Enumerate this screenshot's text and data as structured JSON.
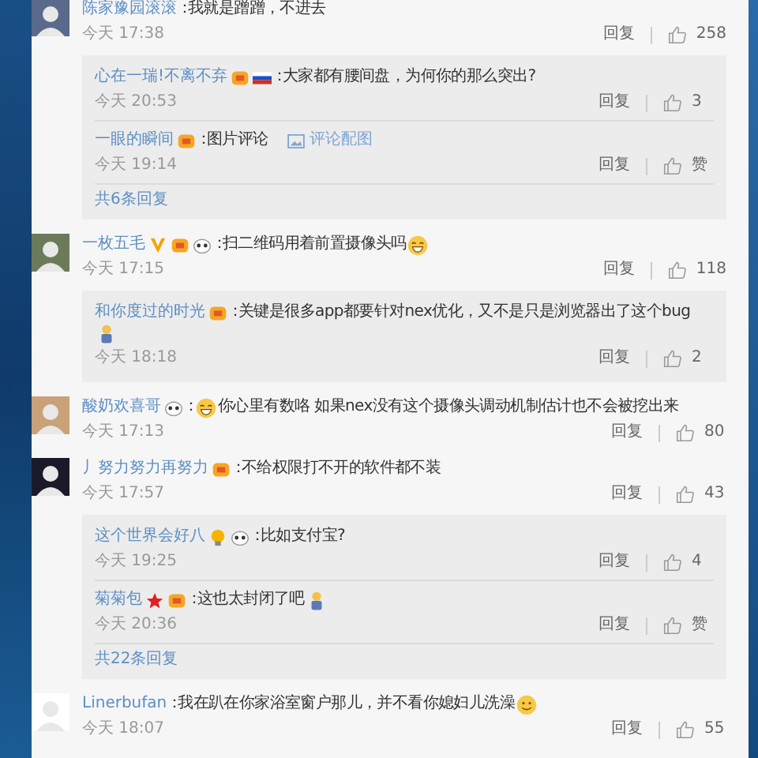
{
  "comments": [
    {
      "user": "陈家豫园滚滚",
      "colon": "：",
      "text": "我就是蹭蹭，不进去",
      "time": "今天 17:38",
      "reply": "回复",
      "likes": "258",
      "replies": [
        {
          "user": "心在一瑞!不离不弃",
          "badges": [
            {
              "kind": "member"
            },
            {
              "kind": "flag"
            }
          ],
          "colon": "：",
          "text": "大家都有腰间盘，为何你的那么突出?",
          "time": "今天 20:53",
          "reply": "回复",
          "likes": "3"
        },
        {
          "user": "一眼的瞬间",
          "badges": [
            {
              "kind": "member"
            }
          ],
          "colon": "：",
          "text": "图片评论",
          "attachment": "评论配图",
          "time": "今天 19:14",
          "reply": "回复",
          "likes": "赞"
        }
      ],
      "more": "共6条回复"
    },
    {
      "user": "一枚五毛",
      "badges": [
        {
          "kind": "vip"
        },
        {
          "kind": "member"
        },
        {
          "kind": "panda"
        }
      ],
      "colon": "：",
      "text": "扫二维码用着前置摄像头吗",
      "emoji_after": {
        "kind": "grin"
      },
      "time": "今天 17:15",
      "reply": "回复",
      "likes": "118",
      "replies": [
        {
          "user": "和你度过的时光",
          "badges": [
            {
              "kind": "member"
            }
          ],
          "colon": "：",
          "text": "关键是很多app都要针对nex优化，又不是只是浏览器出了这个bug",
          "emoji_after": {
            "kind": "figure"
          },
          "time": "今天 18:18",
          "reply": "回复",
          "likes": "2"
        }
      ]
    },
    {
      "user": "酸奶欢喜哥",
      "badges": [
        {
          "kind": "panda"
        }
      ],
      "colon": "：",
      "emoji_before": {
        "kind": "grin"
      },
      "text": "你心里有数咯 如果nex没有这个摄像头调动机制估计也不会被挖出来",
      "time": "今天 17:13",
      "reply": "回复",
      "likes": "80"
    },
    {
      "user": "丿努力努力再努力",
      "badges": [
        {
          "kind": "member"
        }
      ],
      "colon": "：",
      "text": "不给权限打不开的软件都不装",
      "time": "今天 17:57",
      "reply": "回复",
      "likes": "43",
      "replies": [
        {
          "user": "这个世界会好八",
          "badges": [
            {
              "kind": "bulb"
            },
            {
              "kind": "panda"
            }
          ],
          "colon": "：",
          "text": "比如支付宝?",
          "time": "今天 19:25",
          "reply": "回复",
          "likes": "4"
        },
        {
          "user": "菊菊包",
          "badges": [
            {
              "kind": "star"
            },
            {
              "kind": "member"
            }
          ],
          "colon": "：",
          "text": "这也太封闭了吧",
          "emoji_after": {
            "kind": "figure"
          },
          "time": "今天 20:36",
          "reply": "回复",
          "likes": "赞"
        }
      ],
      "more": "共22条回复"
    },
    {
      "user": "Linerbufan",
      "colon": "：",
      "text": "我在趴在你家浴室窗户那儿，并不看你媳妇儿洗澡",
      "emoji_after": {
        "kind": "smile"
      },
      "time": "今天 18:07",
      "reply": "回复",
      "likes": "55"
    }
  ]
}
